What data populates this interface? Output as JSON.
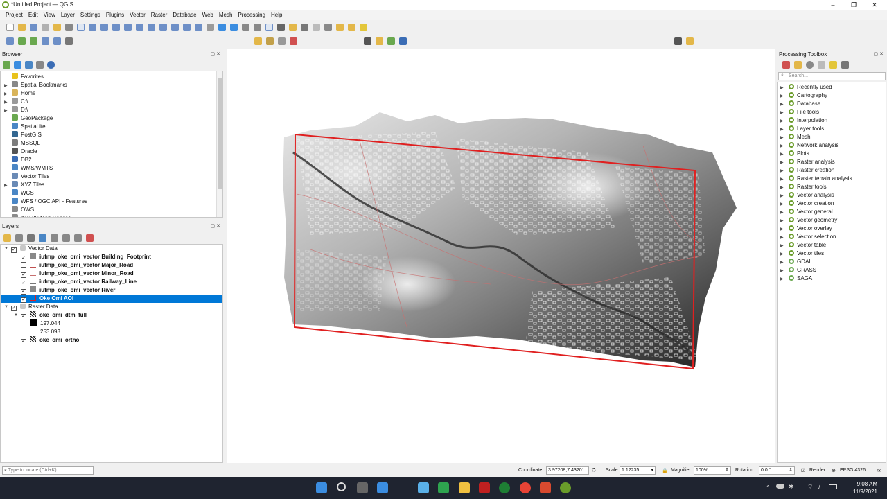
{
  "window": {
    "title": "*Untitled Project — QGIS",
    "minimize_glyph": "–",
    "restore_glyph": "❐",
    "close_glyph": "✕"
  },
  "menu": [
    "Project",
    "Edit",
    "View",
    "Layer",
    "Settings",
    "Plugins",
    "Vector",
    "Raster",
    "Database",
    "Web",
    "Mesh",
    "Processing",
    "Help"
  ],
  "browser": {
    "title": "Browser",
    "items": [
      {
        "label": "Favorites",
        "icon": "star-icon",
        "color": "#e8c21c",
        "arrow": false
      },
      {
        "label": "Spatial Bookmarks",
        "icon": "bookmark-icon",
        "color": "#888888",
        "arrow": true
      },
      {
        "label": "Home",
        "icon": "home-folder-icon",
        "color": "#d9b45a",
        "arrow": true
      },
      {
        "label": "C:\\",
        "icon": "drive-icon",
        "color": "#9a9a9a",
        "arrow": true
      },
      {
        "label": "D:\\",
        "icon": "drive-icon",
        "color": "#9a9a9a",
        "arrow": true
      },
      {
        "label": "GeoPackage",
        "icon": "geopackage-icon",
        "color": "#6aa84f",
        "arrow": false
      },
      {
        "label": "SpatiaLite",
        "icon": "spatialite-icon",
        "color": "#4a86c5",
        "arrow": false
      },
      {
        "label": "PostGIS",
        "icon": "postgis-icon",
        "color": "#336791",
        "arrow": false
      },
      {
        "label": "MSSQL",
        "icon": "mssql-icon",
        "color": "#7d7d7d",
        "arrow": false
      },
      {
        "label": "Oracle",
        "icon": "oracle-icon",
        "color": "#555555",
        "arrow": false
      },
      {
        "label": "DB2",
        "icon": "db2-icon",
        "color": "#3b6db5",
        "arrow": false
      },
      {
        "label": "WMS/WMTS",
        "icon": "globe-icon",
        "color": "#4a86c5",
        "arrow": false
      },
      {
        "label": "Vector Tiles",
        "icon": "vector-tiles-icon",
        "color": "#6a8ab5",
        "arrow": false
      },
      {
        "label": "XYZ Tiles",
        "icon": "xyz-tiles-icon",
        "color": "#6a8ab5",
        "arrow": true
      },
      {
        "label": "WCS",
        "icon": "globe-icon",
        "color": "#4a86c5",
        "arrow": false
      },
      {
        "label": "WFS / OGC API - Features",
        "icon": "globe-icon",
        "color": "#4a86c5",
        "arrow": false
      },
      {
        "label": "OWS",
        "icon": "ows-icon",
        "color": "#8a8a8a",
        "arrow": false
      },
      {
        "label": "ArcGIS Map Service",
        "icon": "arcgis-icon",
        "color": "#8a8a8a",
        "arrow": false
      }
    ]
  },
  "layers": {
    "title": "Layers",
    "groups": [
      {
        "name": "Vector Data",
        "layers": [
          {
            "name": "iufmp_oke_omi_vector Building_Footprint",
            "checked": true,
            "swatch": "#888888",
            "selected": false
          },
          {
            "name": "iufmp_oke_omi_vector Major_Road",
            "checked": false,
            "swatch": "#c05050",
            "selected": false
          },
          {
            "name": "iufmp_oke_omi_vector Minor_Road",
            "checked": true,
            "swatch": "#c87070",
            "selected": false
          },
          {
            "name": "iufmp_oke_omi_vector Railway_Line",
            "checked": true,
            "swatch": "#777777",
            "selected": false
          },
          {
            "name": "iufmp_oke_omi_vector River",
            "checked": true,
            "swatch": "#8a8a8a",
            "selected": false
          },
          {
            "name": "Oke Omi AOI",
            "checked": true,
            "swatch": "#e02020",
            "selected": true
          }
        ]
      },
      {
        "name": "Raster Data",
        "layers": [
          {
            "name": "oke_omi_dtm_full",
            "checked": true,
            "legend": [
              "197.044",
              "253.093"
            ]
          },
          {
            "name": "oke_omi_ortho",
            "checked": true
          }
        ]
      }
    ]
  },
  "toolbox": {
    "title": "Processing Toolbox",
    "search_placeholder": "Search...",
    "items": [
      "Recently used",
      "Cartography",
      "Database",
      "File tools",
      "Interpolation",
      "Layer tools",
      "Mesh",
      "Network analysis",
      "Plots",
      "Raster analysis",
      "Raster creation",
      "Raster terrain analysis",
      "Raster tools",
      "Vector analysis",
      "Vector creation",
      "Vector general",
      "Vector geometry",
      "Vector overlay",
      "Vector selection",
      "Vector table",
      "Vector tiles",
      "GDAL",
      "GRASS",
      "SAGA"
    ]
  },
  "status": {
    "locator_placeholder": "Type to locate (Ctrl+K)",
    "coordinate_label": "Coordinate",
    "coordinate_value": "3.97208,7.43201",
    "scale_label": "Scale",
    "scale_value": "1:12235",
    "magnifier_label": "Magnifier",
    "magnifier_value": "100%",
    "rotation_label": "Rotation",
    "rotation_value": "0.0 °",
    "render_label": "Render",
    "crs": "EPSG:4326"
  },
  "taskbar": {
    "time": "9:08 AM",
    "date": "11/9/2021"
  },
  "colors": {
    "selection": "#0078d7",
    "aoi_outline": "#e02020",
    "qgis_green": "#6a9c2a"
  }
}
